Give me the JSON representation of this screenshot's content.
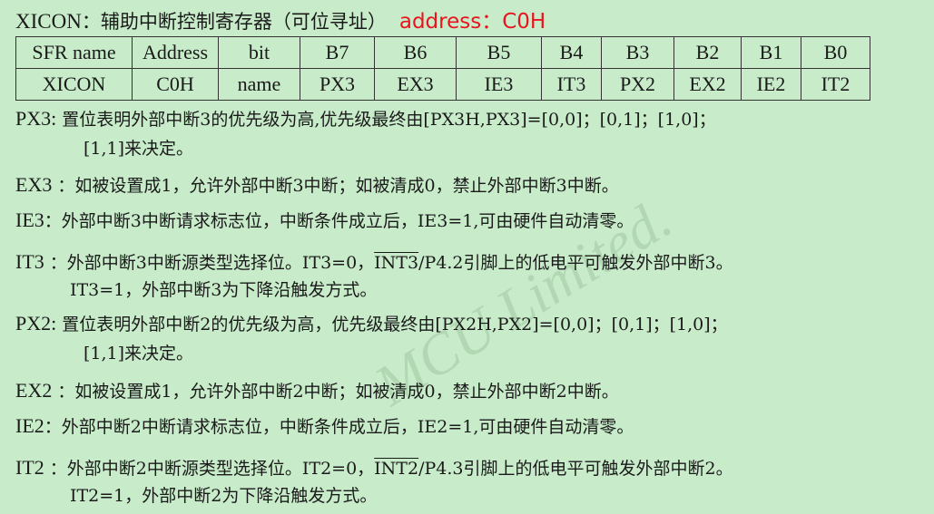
{
  "title": {
    "reg": "XICON",
    "desc": "：辅助中断控制寄存器（可位寻址）",
    "address": "address：C0H"
  },
  "table": {
    "header": [
      "SFR name",
      "Address",
      "bit",
      "B7",
      "B6",
      "B5",
      "B4",
      "B3",
      "B2",
      "B1",
      "B0"
    ],
    "row": [
      "XICON",
      "C0H",
      "name",
      "PX3",
      "EX3",
      "IE3",
      "IT3",
      "PX2",
      "EX2",
      "IE2",
      "IT2"
    ]
  },
  "bits": [
    {
      "label": "PX3:",
      "text": " 置位表明外部中断3的优先级为高,优先级最终由[PX3H,PX3]=[0,0]；[0,1]；[1,0]；",
      "cont": "[1,1]来决定。"
    },
    {
      "label": "EX3",
      "text": " ：如被设置成1，允许外部中断3中断；如被清成0，禁止外部中断3中断。"
    },
    {
      "label": "IE3",
      "text": "：外部中断3中断请求标志位，中断条件成立后，IE3=1,可由硬件自动清零。"
    },
    {
      "label": "IT3",
      "pre": " ：外部中断3中断源类型选择位。IT3=0，",
      "over": "INT3",
      "post": "/P4.2引脚上的低电平可触发外部中断3。",
      "cont": "IT3=1，外部中断3为下降沿触发方式。"
    },
    {
      "label": "PX2:",
      "text": " 置位表明外部中断2的优先级为高，优先级最终由[PX2H,PX2]=[0,0]；[0,1]；[1,0]；",
      "cont": "[1,1]来决定。"
    },
    {
      "label": "EX2",
      "text": " ：如被设置成1，允许外部中断2中断；如被清成0，禁止外部中断2中断。"
    },
    {
      "label": "IE2",
      "text": "：外部中断2中断请求标志位，中断条件成立后，IE2=1,可由硬件自动清零。"
    },
    {
      "label": "IT2",
      "pre": " ：外部中断2中断源类型选择位。IT2=0，",
      "over": "INT2",
      "post": "/P4.3引脚上的低电平可触发外部中断2。",
      "cont": "IT2=1，外部中断2为下降沿触发方式。"
    }
  ],
  "watermark": "MCU Limited."
}
